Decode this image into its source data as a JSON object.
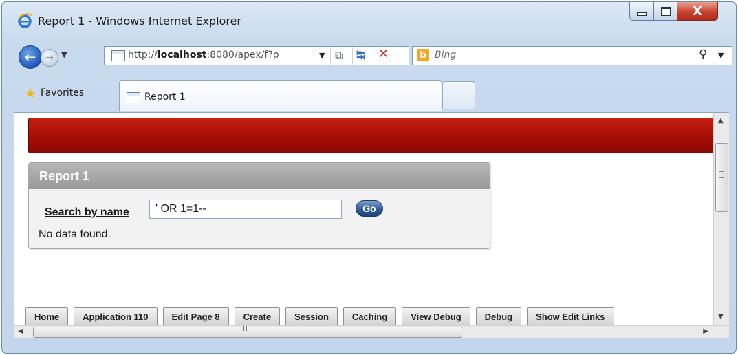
{
  "window": {
    "title": "Report 1 - Windows Internet Explorer",
    "close_glyph": "X"
  },
  "nav": {
    "back_glyph": "←",
    "forward_glyph": "→",
    "dropdown_glyph": "▼",
    "address": {
      "prefix": "http://",
      "host": "localhost",
      "rest": ":8080/apex/f?p"
    },
    "compat_glyph": "⧉",
    "refresh_glyph": "↹",
    "stop_glyph": "✕",
    "search_placeholder": "Bing",
    "bing_logo": "b",
    "search_glyph": "⚲"
  },
  "favorites": {
    "label": "Favorites",
    "star_glyph": "★"
  },
  "tabs": [
    {
      "label": "Report 1"
    }
  ],
  "page": {
    "region_title": "Report 1",
    "search_label": "Search by name",
    "search_value": "' OR 1=1--",
    "go_label": "Go",
    "no_data_message": "No data found."
  },
  "dev_toolbar": {
    "buttons": [
      "Home",
      "Application 110",
      "Edit Page 8",
      "Create",
      "Session",
      "Caching",
      "View Debug",
      "Debug",
      "Show Edit Links"
    ]
  },
  "scrollbars": {
    "up": "▲",
    "down": "▼",
    "left": "◀",
    "right": "▶",
    "h_grip": "III"
  },
  "colors": {
    "banner": "#a50d05",
    "go_button": "#2a5996",
    "close_button": "#c8412d"
  }
}
